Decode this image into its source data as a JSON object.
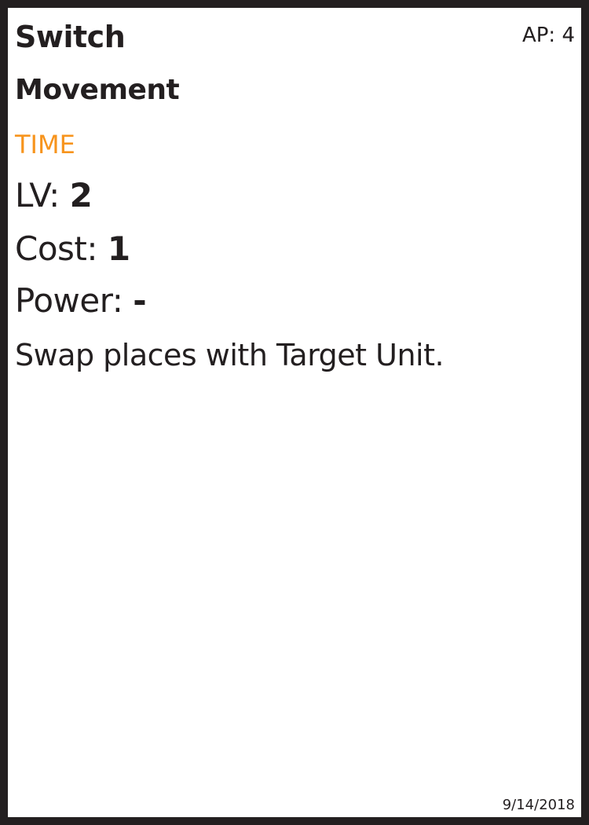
{
  "card": {
    "name": "Switch",
    "ap_label": "AP: 4",
    "category": "Movement",
    "element": "TIME",
    "lv_label": "LV:",
    "lv_value": "2",
    "cost_label": "Cost:",
    "cost_value": "1",
    "power_label": "Power:",
    "power_value": "-",
    "description": "Swap places with Target Unit.",
    "date": "9/14/2018"
  },
  "colors": {
    "border": "#231f20",
    "text": "#231f20",
    "element": "#f7941d",
    "background": "#ffffff"
  }
}
